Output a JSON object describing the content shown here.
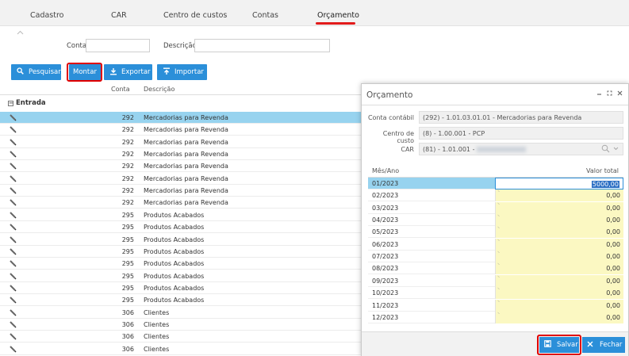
{
  "tabs": [
    {
      "label": "Cadastro"
    },
    {
      "label": "CAR"
    },
    {
      "label": "Centro de custos"
    },
    {
      "label": "Contas"
    },
    {
      "label": "Orçamento"
    }
  ],
  "filters": {
    "conta_label": "Conta",
    "conta_value": "",
    "descricao_label": "Descrição",
    "descricao_value": ""
  },
  "toolbar": {
    "pesquisar": "Pesquisar",
    "montar": "Montar",
    "exportar": "Exportar",
    "importar": "Importar"
  },
  "grid": {
    "columns": {
      "conta": "Conta",
      "descricao": "Descrição"
    },
    "group": "Entrada",
    "rows": [
      {
        "conta": "292",
        "descricao": "Mercadorias para Revenda"
      },
      {
        "conta": "292",
        "descricao": "Mercadorias para Revenda"
      },
      {
        "conta": "292",
        "descricao": "Mercadorias para Revenda"
      },
      {
        "conta": "292",
        "descricao": "Mercadorias para Revenda"
      },
      {
        "conta": "292",
        "descricao": "Mercadorias para Revenda"
      },
      {
        "conta": "292",
        "descricao": "Mercadorias para Revenda"
      },
      {
        "conta": "292",
        "descricao": "Mercadorias para Revenda"
      },
      {
        "conta": "292",
        "descricao": "Mercadorias para Revenda"
      },
      {
        "conta": "295",
        "descricao": "Produtos Acabados"
      },
      {
        "conta": "295",
        "descricao": "Produtos Acabados"
      },
      {
        "conta": "295",
        "descricao": "Produtos Acabados"
      },
      {
        "conta": "295",
        "descricao": "Produtos Acabados"
      },
      {
        "conta": "295",
        "descricao": "Produtos Acabados"
      },
      {
        "conta": "295",
        "descricao": "Produtos Acabados"
      },
      {
        "conta": "295",
        "descricao": "Produtos Acabados"
      },
      {
        "conta": "295",
        "descricao": "Produtos Acabados"
      },
      {
        "conta": "306",
        "descricao": "Clientes"
      },
      {
        "conta": "306",
        "descricao": "Clientes"
      },
      {
        "conta": "306",
        "descricao": "Clientes"
      },
      {
        "conta": "306",
        "descricao": "Clientes"
      }
    ]
  },
  "modal": {
    "title": "Orçamento",
    "conta_contabil_label": "Conta contábil",
    "conta_contabil_value": "(292) - 1.01.03.01.01 - Mercadorias para Revenda",
    "centro_custo_label": "Centro de custo",
    "centro_custo_value": "(8) - 1.00.001 - PCP",
    "car_label": "CAR",
    "car_value": "(81) - 1.01.001 -",
    "col_mes": "Mês/Ano",
    "col_valor": "Valor total",
    "rows": [
      {
        "mes": "01/2023",
        "valor": "5000,00"
      },
      {
        "mes": "02/2023",
        "valor": "0,00"
      },
      {
        "mes": "03/2023",
        "valor": "0,00"
      },
      {
        "mes": "04/2023",
        "valor": "0,00"
      },
      {
        "mes": "05/2023",
        "valor": "0,00"
      },
      {
        "mes": "06/2023",
        "valor": "0,00"
      },
      {
        "mes": "07/2023",
        "valor": "0,00"
      },
      {
        "mes": "08/2023",
        "valor": "0,00"
      },
      {
        "mes": "09/2023",
        "valor": "0,00"
      },
      {
        "mes": "10/2023",
        "valor": "0,00"
      },
      {
        "mes": "11/2023",
        "valor": "0,00"
      },
      {
        "mes": "12/2023",
        "valor": "0,00"
      }
    ],
    "salvar": "Salvar",
    "fechar": "Fechar"
  },
  "colors": {
    "accent": "#2b8fd9",
    "highlight": "#e00000",
    "selected_row": "#97d3ef",
    "editable_cell": "#fbf8c2"
  }
}
